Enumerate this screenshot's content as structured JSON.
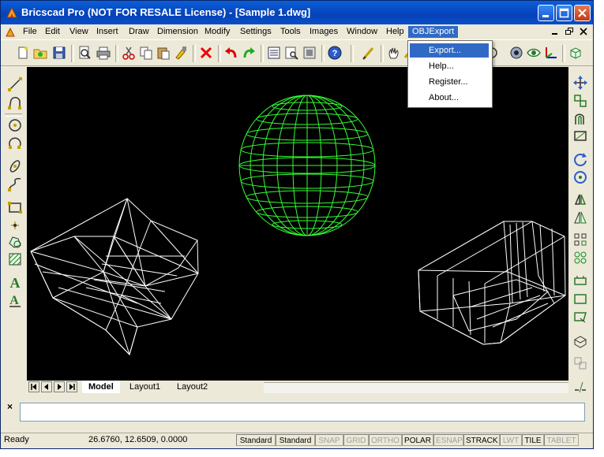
{
  "window": {
    "title": "Bricscad Pro (NOT FOR RESALE License) - [Sample 1.dwg]"
  },
  "menubar": {
    "items": [
      {
        "label": "File"
      },
      {
        "label": "Edit"
      },
      {
        "label": "View"
      },
      {
        "label": "Insert"
      },
      {
        "label": "Draw"
      },
      {
        "label": "Dimension"
      },
      {
        "label": "Modify"
      },
      {
        "label": "Settings"
      },
      {
        "label": "Tools"
      },
      {
        "label": "Images"
      },
      {
        "label": "Window"
      },
      {
        "label": "Help"
      },
      {
        "label": "OBJExport"
      }
    ]
  },
  "dropdown": {
    "items": [
      {
        "label": "Export..."
      },
      {
        "label": "Help..."
      },
      {
        "label": "Register..."
      },
      {
        "label": "About..."
      }
    ]
  },
  "layout_tabs": {
    "tabs": [
      {
        "label": "Model"
      },
      {
        "label": "Layout1"
      },
      {
        "label": "Layout2"
      }
    ]
  },
  "command": {
    "close_glyph": "×"
  },
  "status": {
    "ready": "Ready",
    "coords": "26.6760, 12.6509, 0.0000",
    "cells": [
      {
        "label": "Standard",
        "on": true
      },
      {
        "label": "Standard",
        "on": true
      },
      {
        "label": "SNAP",
        "on": false
      },
      {
        "label": "GRID",
        "on": false
      },
      {
        "label": "ORTHO",
        "on": false
      },
      {
        "label": "POLAR",
        "on": true
      },
      {
        "label": "ESNAP",
        "on": false
      },
      {
        "label": "STRACK",
        "on": true
      },
      {
        "label": "LWT",
        "on": false
      },
      {
        "label": "TILE",
        "on": true
      },
      {
        "label": "TABLET",
        "on": false
      }
    ]
  },
  "colors": {
    "titlebar": "#0a4fc8",
    "menu_highlight": "#316ac5",
    "canvas_background": "#000000",
    "sphere_wireframe": "#33ff33",
    "solid_wireframe": "#ffffff"
  }
}
